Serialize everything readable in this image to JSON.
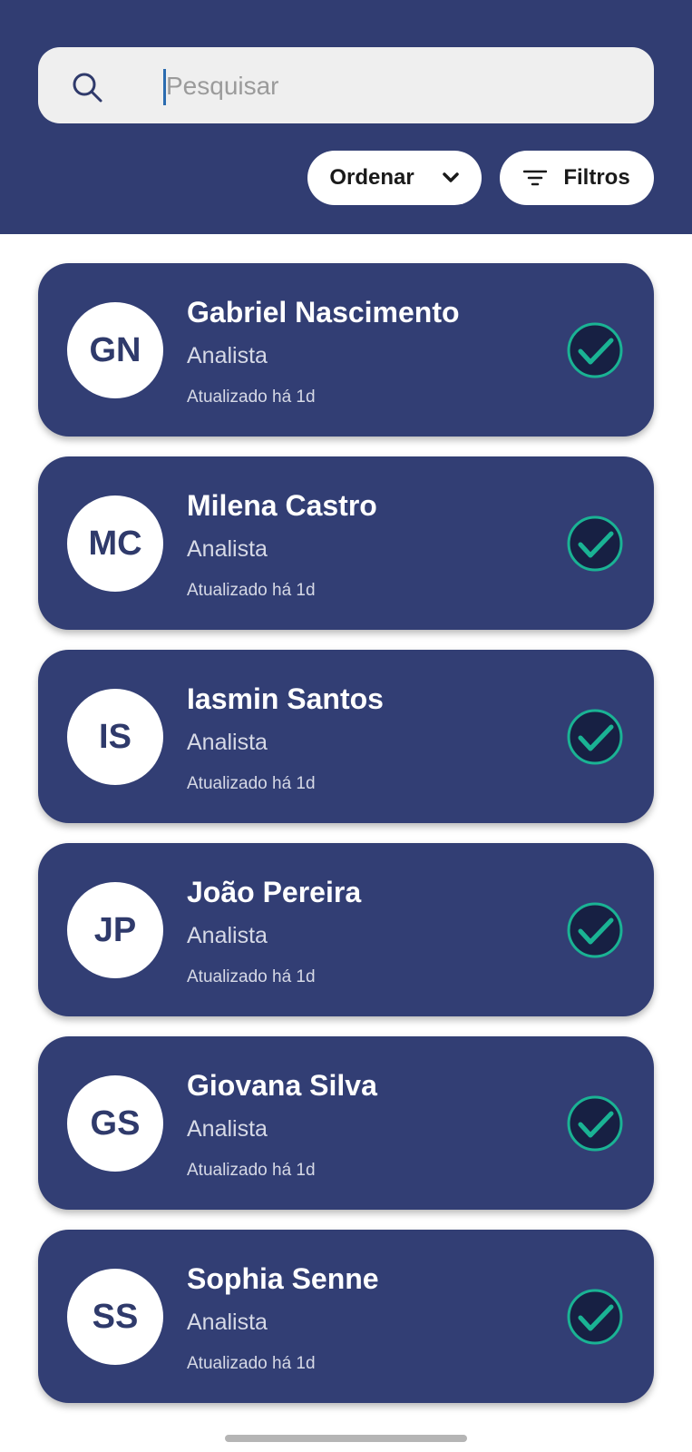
{
  "search": {
    "placeholder": "Pesquisar",
    "value": ""
  },
  "toolbar": {
    "order_label": "Ordenar",
    "filter_label": "Filtros"
  },
  "colors": {
    "header": "#313d72",
    "card": "#323e74",
    "check_accent": "#1ab394",
    "avatar_text": "#2f3a6b"
  },
  "contacts": [
    {
      "initials": "GN",
      "name": "Gabriel Nascimento",
      "role": "Analista",
      "updated": "Atualizado há 1d",
      "checked": true
    },
    {
      "initials": "MC",
      "name": "Milena Castro",
      "role": "Analista",
      "updated": "Atualizado há 1d",
      "checked": true
    },
    {
      "initials": "IS",
      "name": "Iasmin Santos",
      "role": "Analista",
      "updated": "Atualizado há 1d",
      "checked": true
    },
    {
      "initials": "JP",
      "name": "João Pereira",
      "role": "Analista",
      "updated": "Atualizado há 1d",
      "checked": true
    },
    {
      "initials": "GS",
      "name": "Giovana Silva",
      "role": "Analista",
      "updated": "Atualizado há 1d",
      "checked": true
    },
    {
      "initials": "SS",
      "name": "Sophia Senne",
      "role": "Analista",
      "updated": "Atualizado há 1d",
      "checked": true
    }
  ]
}
